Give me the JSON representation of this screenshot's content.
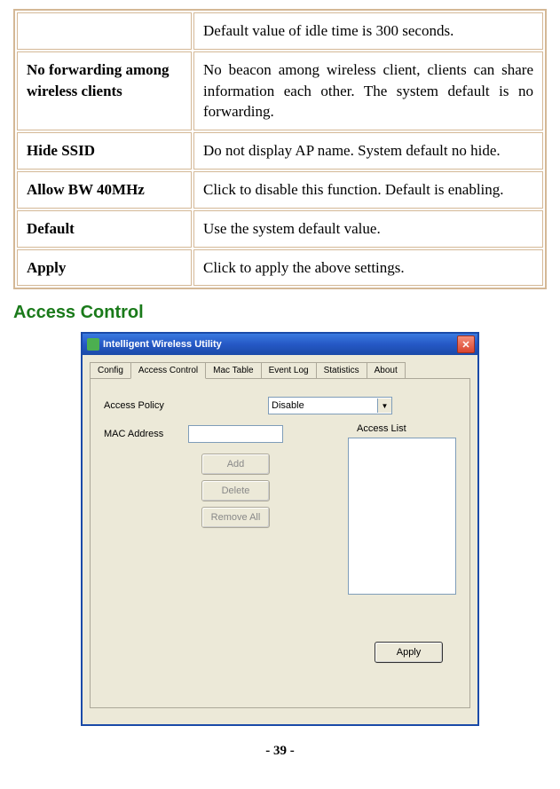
{
  "table": {
    "rows": [
      {
        "label": "",
        "desc": "Default value of idle time is 300 seconds."
      },
      {
        "label": "No forwarding among wireless clients",
        "desc": "No beacon among wireless client, clients can share information each other. The system default is no forwarding."
      },
      {
        "label": "Hide SSID",
        "desc": "Do not display AP name. System default no hide."
      },
      {
        "label": "Allow BW 40MHz",
        "desc": "Click to disable this function. Default is enabling."
      },
      {
        "label": "Default",
        "desc": "Use the system default value."
      },
      {
        "label": "Apply",
        "desc": "Click to apply the above settings."
      }
    ]
  },
  "heading": "Access Control",
  "window": {
    "title": "Intelligent Wireless Utility",
    "tabs": [
      "Config",
      "Access Control",
      "Mac Table",
      "Event Log",
      "Statistics",
      "About"
    ],
    "form": {
      "access_policy_label": "Access Policy",
      "access_policy_value": "Disable",
      "mac_address_label": "MAC Address",
      "access_list_label": "Access List"
    },
    "buttons": {
      "add": "Add",
      "delete": "Delete",
      "remove_all": "Remove All",
      "apply": "Apply"
    }
  },
  "page_number": "- 39 -"
}
